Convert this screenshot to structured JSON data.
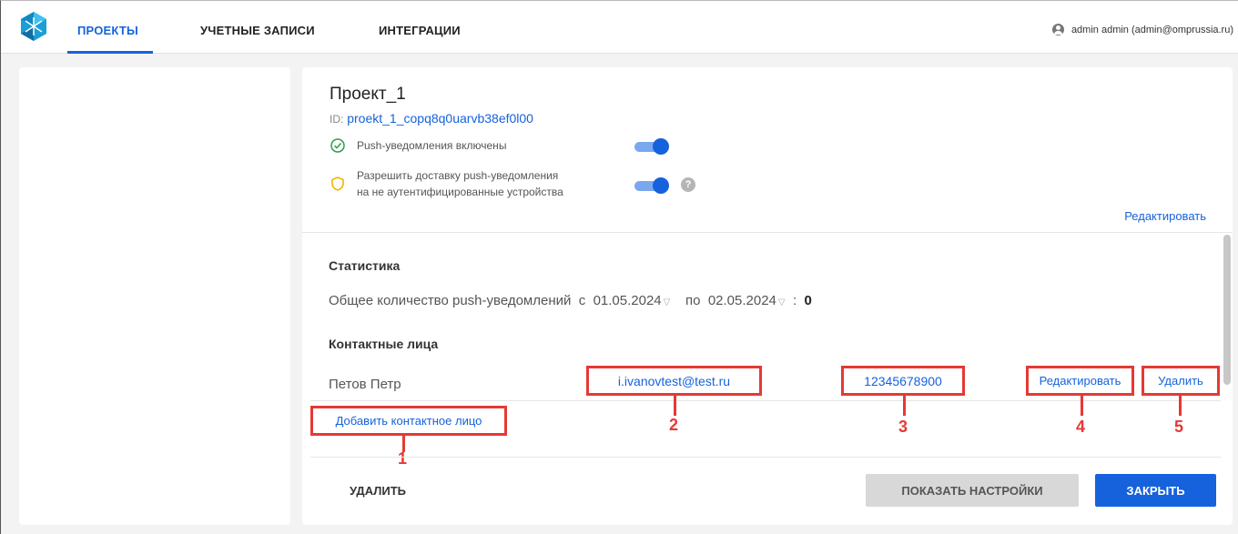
{
  "header": {
    "tabs": [
      {
        "label": "ПРОЕКТЫ",
        "active": true
      },
      {
        "label": "УЧЕТНЫЕ ЗАПИСИ",
        "active": false
      },
      {
        "label": "ИНТЕГРАЦИИ",
        "active": false
      }
    ],
    "user": "admin admin (admin@omprussia.ru)"
  },
  "project": {
    "title": "Проект_1",
    "id_label": "ID:",
    "id_value": "proekt_1_copq8q0uarvb38ef0l00",
    "push_enabled_label": "Push-уведомления включены",
    "push_enabled": true,
    "unauth_delivery_label_1": "Разрешить доставку push-уведомления",
    "unauth_delivery_label_2": "на не аутентифицированные устройства",
    "unauth_delivery_enabled": true,
    "help_symbol": "?",
    "edit_label": "Редактировать"
  },
  "stats": {
    "title": "Статистика",
    "total_label": "Общее количество push-уведомлений",
    "from_label": "с",
    "from_date": "01.05.2024",
    "to_label": "по",
    "to_date": "02.05.2024",
    "separator": ":",
    "count": "0"
  },
  "contacts": {
    "title": "Контактные лица",
    "items": [
      {
        "name": "Петов Петр",
        "email": "i.ivanovtest@test.ru",
        "phone": "12345678900",
        "edit_label": "Редактировать",
        "delete_label": "Удалить"
      }
    ],
    "add_label": "Добавить контактное лицо"
  },
  "callouts": [
    "1",
    "2",
    "3",
    "4",
    "5"
  ],
  "footer": {
    "delete_label": "УДАЛИТЬ",
    "settings_label": "ПОКАЗАТЬ НАСТРОЙКИ",
    "close_label": "ЗАКРЫТЬ"
  },
  "colors": {
    "accent": "#1662dd",
    "highlight": "#e53935",
    "success": "#2e9c4b",
    "warning": "#f5b400"
  }
}
